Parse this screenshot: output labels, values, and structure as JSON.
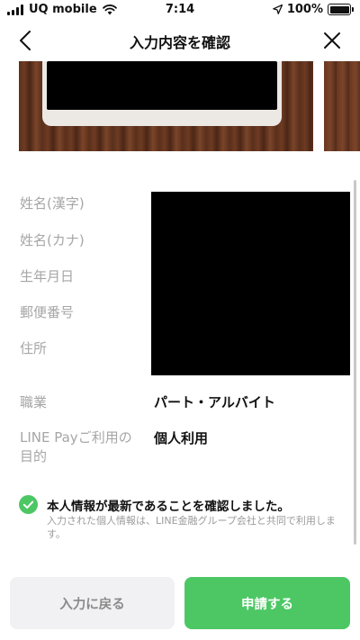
{
  "status_bar": {
    "carrier": "UQ mobile",
    "time": "7:14",
    "battery": "100%"
  },
  "header": {
    "title": "入力内容を確認"
  },
  "info": {
    "name_kanji_label": "姓名(漢字)",
    "name_kana_label": "姓名(カナ)",
    "birthdate_label": "生年月日",
    "postal_code_label": "郵便番号",
    "address_label": "住所",
    "occupation_label": "職業",
    "occupation_value": "パート・アルバイト",
    "purpose_label_line1": "LINE Payご利用の",
    "purpose_label_line2": "目的",
    "purpose_value": "個人利用"
  },
  "confirmation": {
    "checked": true,
    "title": "本人情報が最新であることを確認しました。",
    "note": "入力された個人情報は、LINE金融グループ会社と共同で利用します。"
  },
  "buttons": {
    "back_label": "入力に戻る",
    "submit_label": "申請する"
  },
  "colors": {
    "accent_green": "#4cc764",
    "secondary_button": "#f1f1f3",
    "label_gray": "#a6a6a6"
  }
}
